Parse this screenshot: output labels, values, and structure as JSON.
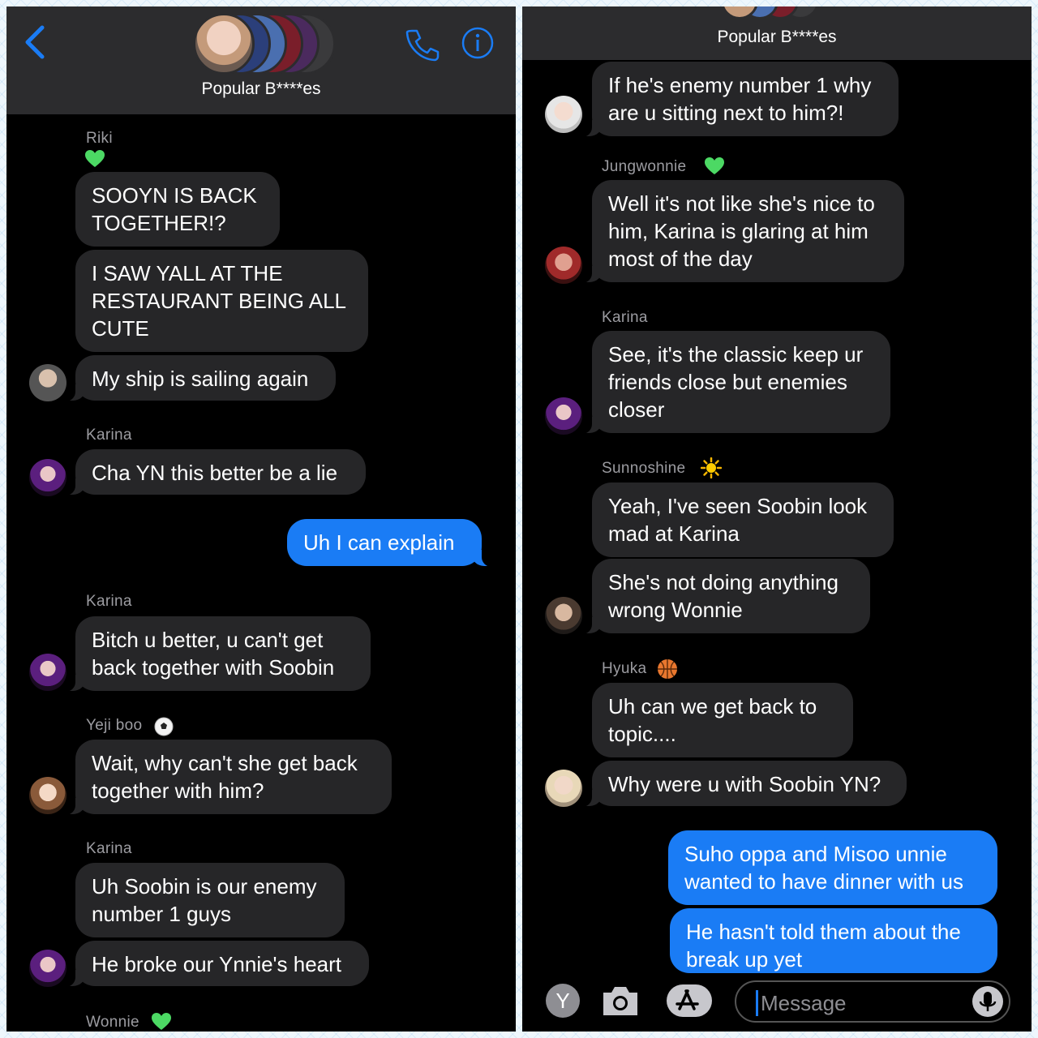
{
  "left": {
    "title": "Popular B****es",
    "names": {
      "riki": "Riki",
      "karina1": "Karina",
      "karina2": "Karina",
      "yeji": "Yeji boo",
      "karina3": "Karina",
      "wonnie": "Wonnie"
    },
    "messages": {
      "m1": "SOOYN IS BACK\nTOGETHER!?",
      "m2": "I SAW YALL AT THE\nRESTAURANT BEING ALL\nCUTE",
      "m3": "My ship is sailing again",
      "m4": "Cha YN this better be a lie",
      "m5": "Uh I can explain",
      "m6": "Bitch u better, u can't get\nback together with Soobin",
      "m7": "Wait, why can't she get back\ntogether with him?",
      "m8": "Uh Soobin is our enemy\nnumber 1 guys",
      "m9": "He broke our Ynnie's heart"
    }
  },
  "right": {
    "title": "Popular B****es",
    "names": {
      "jungwonnie": "Jungwonnie",
      "karina": "Karina",
      "sunnoshine": "Sunnoshine",
      "hyuka": "Hyuka"
    },
    "messages": {
      "r1": "If he's enemy number 1 why\nare u sitting next to him?!",
      "r2": "Well it's not like she's nice to\nhim, Karina is glaring at him\nmost of the day",
      "r3": "See, it's the classic keep ur\nfriends close but enemies\ncloser",
      "r4": "Yeah, I've seen Soobin look\nmad at Karina",
      "r5": "She's not doing anything\nwrong Wonnie",
      "r6": "Uh can we get  back to\ntopic....",
      "r7": "Why were u with Soobin YN?",
      "r8": "Suho oppa and Misoo unnie\nwanted to have dinner with us",
      "r9": "He hasn't told them about the\nbreak up yet"
    },
    "composer": {
      "avatar_letter": "Y",
      "placeholder": "Message"
    }
  },
  "colors": {
    "incoming_bubble": "#262628",
    "outgoing_bubble": "#1a7cf5",
    "header": "#2c2c2e",
    "accent": "#1a7cf5",
    "heart": "#4cd964"
  },
  "icons": [
    "back-chevron-icon",
    "phone-icon",
    "info-icon",
    "green-heart-icon",
    "soccer-ball-icon",
    "sun-icon",
    "basketball-icon",
    "camera-icon",
    "app-store-icon",
    "microphone-icon"
  ]
}
